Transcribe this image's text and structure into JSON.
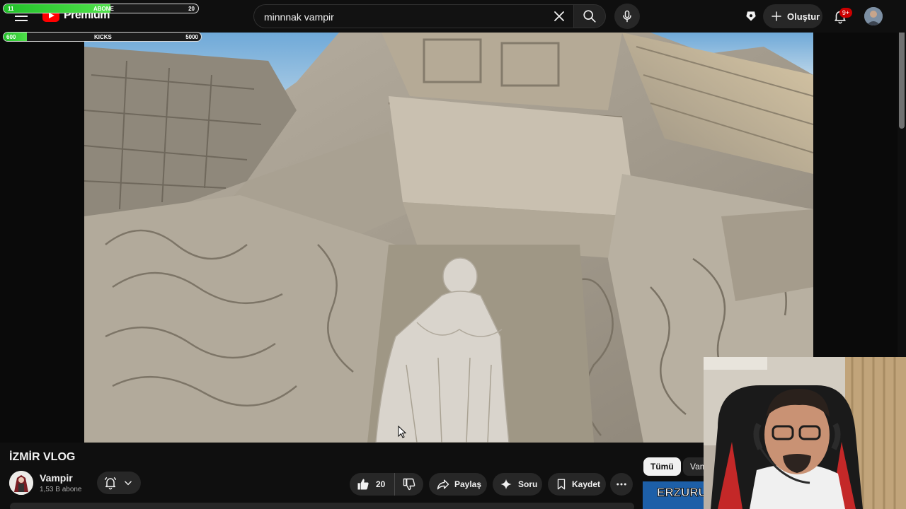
{
  "overlay": {
    "abone_label": "ABONE",
    "abone_current": "11",
    "abone_goal": "20",
    "abone_progress": 0.55,
    "kicks_label": "KICKS",
    "kicks_current": "600",
    "kicks_goal": "5000",
    "kicks_progress": 0.12
  },
  "header": {
    "logo_text": "Premium",
    "search_query": "minnnak vampir",
    "create_label": "Oluştur",
    "notification_count": "9+",
    "icons": [
      "menu-icon",
      "youtube-logo-icon",
      "close-icon",
      "search-icon",
      "mic-icon",
      "cast-icon",
      "plus-icon",
      "bell-icon"
    ]
  },
  "video": {
    "title": "İZMİR VLOG",
    "channel_name": "Vampir",
    "channel_subs": "1,53 B abone",
    "like_count": "20",
    "share_label": "Paylaş",
    "ask_label": "Soru",
    "save_label": "Kaydet"
  },
  "sidebar": {
    "chips": [
      "Tümü",
      "Vampir"
    ],
    "rec_thumb_text": "ERZURUM"
  },
  "colors": {
    "background": "#0f0f0f",
    "pill": "#272727",
    "brand_red": "#ff0000",
    "progress_green": "#3fd13f"
  }
}
